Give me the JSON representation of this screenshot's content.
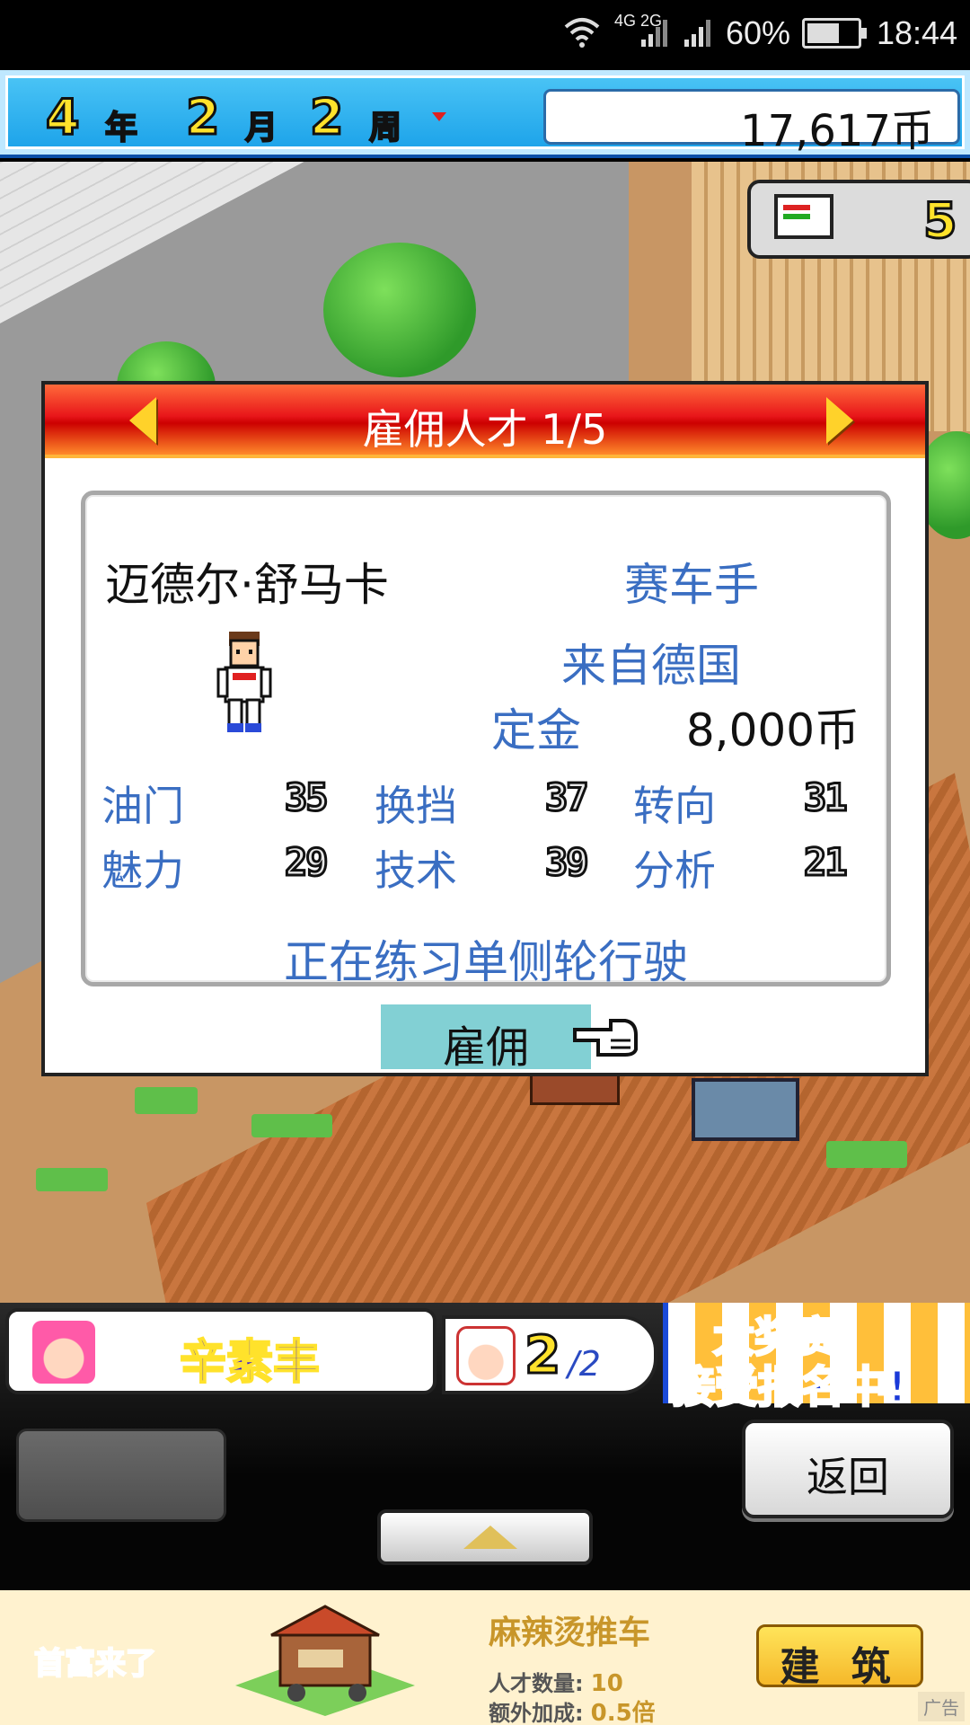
{
  "status_bar": {
    "network": "4G 2G",
    "battery_percent": "60%",
    "time": "18:44",
    "wifi_icon": "wifi-icon",
    "signal_icon": "signal-icon",
    "battery_icon": "battery-icon"
  },
  "hud": {
    "year_num": "4",
    "year_unit": "年",
    "month_num": "2",
    "month_unit": "月",
    "week_num": "2",
    "week_unit": "周",
    "money": "17,617币",
    "staff_count_top": "5"
  },
  "dialog": {
    "title": "雇佣人才 1/5",
    "name": "迈德尔·舒马卡",
    "job": "赛车手",
    "origin": "来自德国",
    "fee_label": "定金",
    "fee_value": "8,000币",
    "stats": [
      {
        "label": "油门",
        "value": "35"
      },
      {
        "label": "换挡",
        "value": "37"
      },
      {
        "label": "转向",
        "value": "31"
      },
      {
        "label": "魅力",
        "value": "29"
      },
      {
        "label": "技术",
        "value": "39"
      },
      {
        "label": "分析",
        "value": "21"
      }
    ],
    "status": "正在练习单侧轮行驶",
    "hire_label": "雇佣"
  },
  "bottom": {
    "character_name": "辛素丰",
    "staff_current": "2",
    "staff_max": "/2",
    "banner_top": "大奖赛",
    "banner_bottom": "接受报名中!",
    "back_label": "返回"
  },
  "ad": {
    "logo": "首富来了",
    "title": "麻辣烫推车",
    "line1_label": "人才数量:",
    "line1_value": "10",
    "line2_label": "额外加成:",
    "line2_value": "0.5倍",
    "button": "建 筑",
    "tag": "广告"
  }
}
